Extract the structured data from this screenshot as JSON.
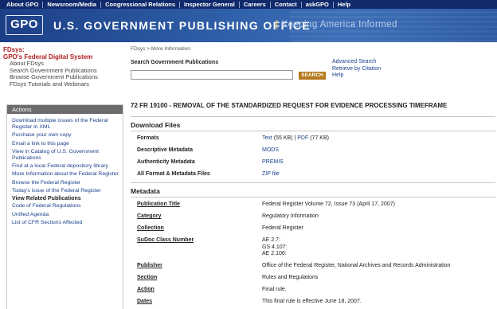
{
  "topnav": [
    "About GPO",
    "Newsroom/Media",
    "Congressional Relations",
    "Inspector General",
    "Careers",
    "Contact",
    "askGPO",
    "Help"
  ],
  "banner": {
    "logo": "GPO",
    "agency": "U.S. GOVERNMENT PUBLISHING OFFICE",
    "tagline_sep": "|",
    "tagline": "Keeping America Informed"
  },
  "left": {
    "title1": "FDsys:",
    "title2": "GPO's Federal Digital System",
    "links": [
      "About FDsys",
      "Search Government Publications",
      "Browse Government Publications",
      "FDsys Tutorials and Webinars"
    ],
    "actions_header": "Actions",
    "actions": [
      "Download multiple issues of the Federal Register in XML",
      "Purchase your own copy",
      "Email a link to this page",
      "View in Catalog of U.S. Government Publications",
      "Find at a local Federal depository library",
      "More Information about the Federal Register",
      "Browse the Federal Register",
      "Today's issue of the Federal Register"
    ],
    "related_header": "View Related Publications",
    "related": [
      "Code of Federal Regulations",
      "Unified Agenda",
      "List of CFR Sections Affected"
    ]
  },
  "main": {
    "breadcrumb": "FDsys > More Information",
    "search_label": "Search Government Publications",
    "search_value": "",
    "search_button": "SEARCH",
    "side_links": [
      "Advanced Search",
      "Retrieve by Citation",
      "Help"
    ],
    "doc_title": "72 FR 19100 - REMOVAL OF THE STANDARDIZED REQUEST FOR EVIDENCE PROCESSING TIMEFRAME",
    "download": {
      "title": "Download Files",
      "formats_label": "Formats",
      "text_link": "Text",
      "text_size": "(55 KB)",
      "sep": "|",
      "pdf_link": "PDF",
      "pdf_size": "(77 KB)",
      "descriptive_label": "Descriptive Metadata",
      "descriptive_link": "MODS",
      "authenticity_label": "Authenticity Metadata",
      "authenticity_link": "PREMIS",
      "all_label": "All Format & Metadata Files",
      "all_link": "ZIP file"
    },
    "metadata": {
      "title": "Metadata",
      "rows": [
        {
          "label": "Publication Title",
          "value": "Federal Register Volume 72, Issue 73 (April 17, 2007)"
        },
        {
          "label": "Category",
          "value": "Regulatory Information"
        },
        {
          "label": "Collection",
          "value": "Federal Register"
        },
        {
          "label": "SuDoc Class Number",
          "value": "AE 2.7:"
        },
        {
          "label": "Publisher",
          "value": "Office of the Federal Register, National Archives and Records Administration"
        },
        {
          "label": "Section",
          "value": "Rules and Regulations"
        },
        {
          "label": "Action",
          "value": "Final rule."
        },
        {
          "label": "Dates",
          "value": "This final rule is effective June 18, 2007."
        }
      ],
      "sudoc_extra": [
        "GS 4.107:",
        "AE 2.106:"
      ]
    }
  }
}
